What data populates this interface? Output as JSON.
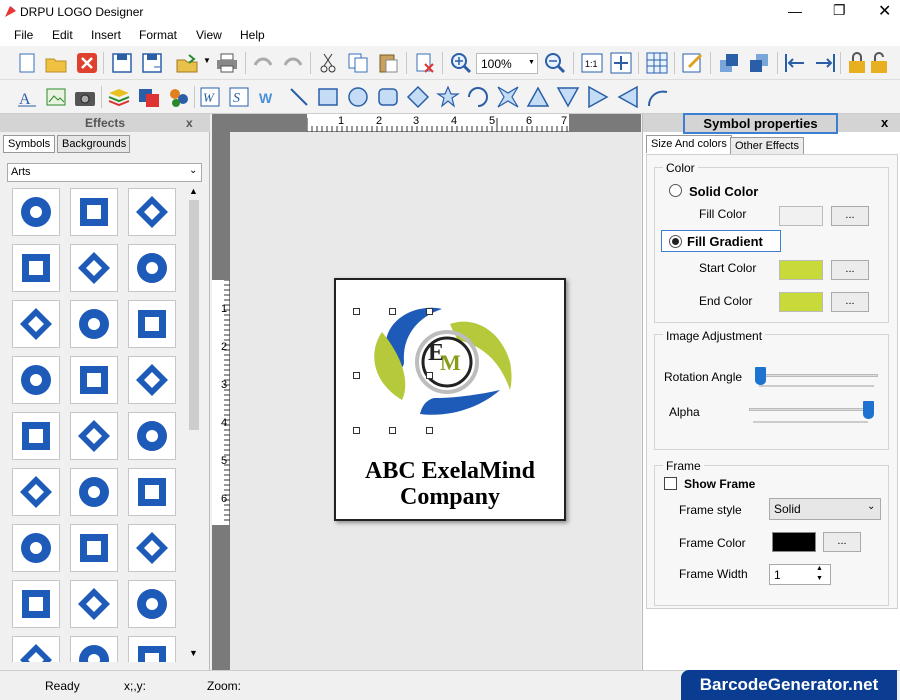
{
  "app": {
    "title": "DRPU LOGO Designer"
  },
  "menu": [
    "File",
    "Edit",
    "Insert",
    "Format",
    "View",
    "Help"
  ],
  "toolbar": {
    "zoom_value": "100%"
  },
  "effects_panel": {
    "title": "Effects",
    "close": "x",
    "tabs": [
      "Symbols",
      "Backgrounds"
    ],
    "category": "Arts"
  },
  "ruler": {
    "top": [
      "1",
      "2",
      "3",
      "4",
      "5",
      "6",
      "7"
    ],
    "left": [
      "1",
      "2",
      "3",
      "4",
      "5",
      "6"
    ]
  },
  "logo": {
    "monogram_e": "E",
    "monogram_m": "M",
    "line1": "ABC ExelaMind",
    "line2": "Company"
  },
  "props_panel": {
    "title": "Symbol properties",
    "close": "x",
    "tabs": [
      "Size And colors",
      "Other Effects"
    ],
    "color_group": "Color",
    "solid_color": "Solid Color",
    "fill_color": "Fill Color",
    "fill_gradient": "Fill Gradient",
    "start_color": "Start Color",
    "end_color": "End Color",
    "dots": "...",
    "image_adjust_group": "Image Adjustment",
    "rotation_angle": "Rotation Angle",
    "alpha": "Alpha",
    "frame_group": "Frame",
    "show_frame": "Show Frame",
    "frame_style": "Frame style",
    "frame_style_value": "Solid",
    "frame_color": "Frame Color",
    "frame_width": "Frame Width",
    "frame_width_value": "1"
  },
  "slider_levels": {
    "rotation": 0.0,
    "alpha": 1.0
  },
  "status": {
    "ready": "Ready",
    "coords": "x;,y:",
    "zoom": "Zoom:"
  },
  "watermark": "BarcodeGenerator.net",
  "colors": {
    "fill_color": "#f1f1f1",
    "start_color": "#c8d93a",
    "end_color": "#c8d93a",
    "frame_color": "#000000",
    "brand_blue": "#1e5bb8",
    "brand_green": "#b5c93a"
  }
}
